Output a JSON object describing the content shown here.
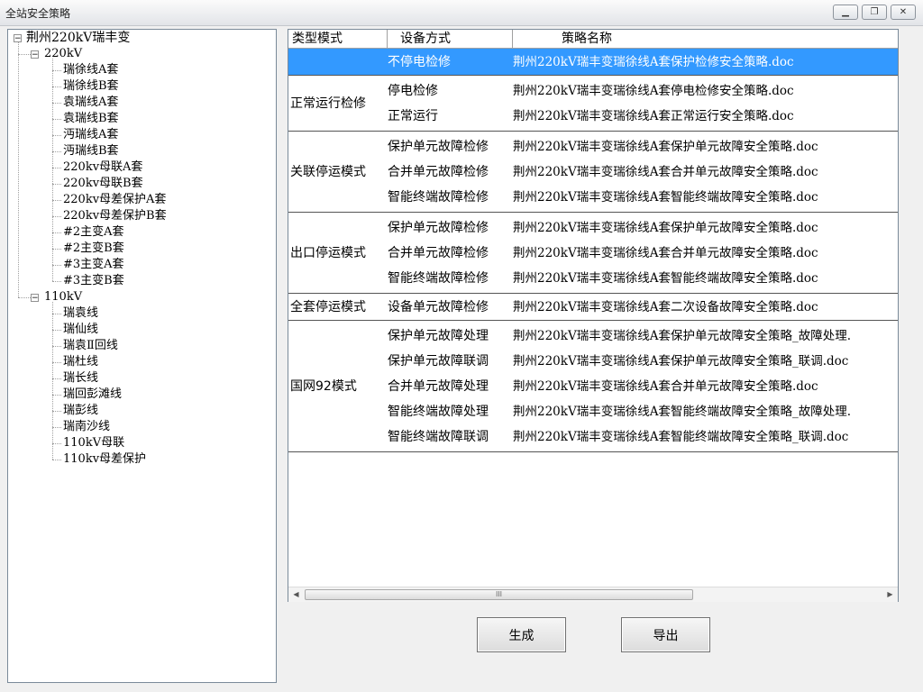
{
  "window": {
    "title": "全站安全策略",
    "controls": [
      "minimize",
      "restore",
      "close"
    ]
  },
  "tree": {
    "root": "荆州220kV瑞丰变",
    "groups": [
      {
        "label": "220kV",
        "items": [
          "瑞徐线A套",
          "瑞徐线B套",
          "袁瑞线A套",
          "袁瑞线B套",
          "沔瑞线A套",
          "沔瑞线B套",
          "220kv母联A套",
          "220kv母联B套",
          "220kv母差保护A套",
          "220kv母差保护B套",
          "#2主变A套",
          "#2主变B套",
          "#3主变A套",
          "#3主变B套"
        ]
      },
      {
        "label": "110kV",
        "items": [
          "瑞袁线",
          "瑞仙线",
          "瑞袁Ⅱ回线",
          "瑞杜线",
          "瑞长线",
          "瑞回彭滩线",
          "瑞彭线",
          "瑞南沙线",
          "110kV母联",
          "110kv母差保护"
        ]
      }
    ]
  },
  "grid": {
    "headers": [
      "类型模式",
      "设备方式",
      "策略名称"
    ],
    "groups": [
      {
        "mode": "",
        "rows": [
          {
            "device": "不停电检修",
            "name": "荆州220kV瑞丰变瑞徐线A套保护检修安全策略.doc",
            "selected": true
          }
        ]
      },
      {
        "mode": "正常运行检修",
        "rows": [
          {
            "device": "停电检修",
            "name": "荆州220kV瑞丰变瑞徐线A套停电检修安全策略.doc"
          },
          {
            "device": "正常运行",
            "name": "荆州220kV瑞丰变瑞徐线A套正常运行安全策略.doc"
          }
        ]
      },
      {
        "mode": "关联停运模式",
        "rows": [
          {
            "device": "保护单元故障检修",
            "name": "荆州220kV瑞丰变瑞徐线A套保护单元故障安全策略.doc"
          },
          {
            "device": "合并单元故障检修",
            "name": "荆州220kV瑞丰变瑞徐线A套合并单元故障安全策略.doc"
          },
          {
            "device": "智能终端故障检修",
            "name": "荆州220kV瑞丰变瑞徐线A套智能终端故障安全策略.doc"
          }
        ]
      },
      {
        "mode": "出口停运模式",
        "rows": [
          {
            "device": "保护单元故障检修",
            "name": "荆州220kV瑞丰变瑞徐线A套保护单元故障安全策略.doc"
          },
          {
            "device": "合并单元故障检修",
            "name": "荆州220kV瑞丰变瑞徐线A套合并单元故障安全策略.doc"
          },
          {
            "device": "智能终端故障检修",
            "name": "荆州220kV瑞丰变瑞徐线A套智能终端故障安全策略.doc"
          }
        ]
      },
      {
        "mode": "全套停运模式",
        "rows": [
          {
            "device": "设备单元故障检修",
            "name": "荆州220kV瑞丰变瑞徐线A套二次设备故障安全策略.doc"
          }
        ]
      },
      {
        "mode": "国网92模式",
        "rows": [
          {
            "device": "保护单元故障处理",
            "name": "荆州220kV瑞丰变瑞徐线A套保护单元故障安全策略_故障处理."
          },
          {
            "device": "保护单元故障联调",
            "name": "荆州220kV瑞丰变瑞徐线A套保护单元故障安全策略_联调.doc"
          },
          {
            "device": "合并单元故障处理",
            "name": "荆州220kV瑞丰变瑞徐线A套合并单元故障安全策略.doc"
          },
          {
            "device": "智能终端故障处理",
            "name": "荆州220kV瑞丰变瑞徐线A套智能终端故障安全策略_故障处理."
          },
          {
            "device": "智能终端故障联调",
            "name": "荆州220kV瑞丰变瑞徐线A套智能终端故障安全策略_联调.doc"
          }
        ]
      }
    ]
  },
  "scrollbar": {
    "thumb_grip": "III"
  },
  "buttons": {
    "generate": "生成",
    "export": "导出"
  },
  "colors": {
    "selection": "#3399ff",
    "selection_text": "#ffffff"
  }
}
